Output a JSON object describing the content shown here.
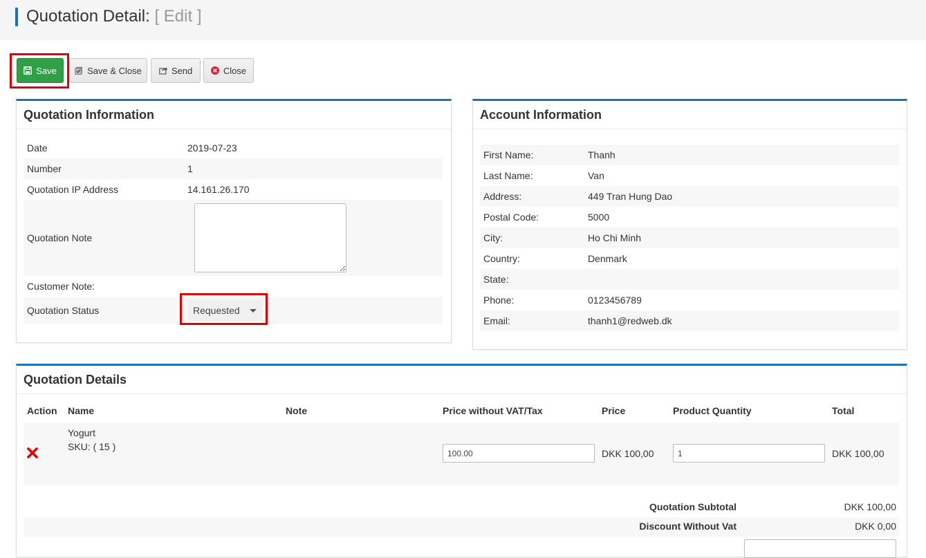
{
  "header": {
    "title": "Quotation Detail:",
    "mode": "[ Edit ]"
  },
  "toolbar": {
    "save": "Save",
    "save_close": "Save & Close",
    "send": "Send",
    "close": "Close"
  },
  "quotation_info": {
    "title": "Quotation Information",
    "rows": [
      {
        "label": "Date",
        "value": "2019-07-23"
      },
      {
        "label": "Number",
        "value": "1"
      },
      {
        "label": "Quotation IP Address",
        "value": "14.161.26.170"
      },
      {
        "label": "Quotation Note",
        "value": ""
      },
      {
        "label": "Customer Note:",
        "value": ""
      },
      {
        "label": "Quotation Status",
        "value": "Requested"
      }
    ]
  },
  "account_info": {
    "title": "Account Information",
    "rows": [
      {
        "label": "First Name:",
        "value": "Thanh"
      },
      {
        "label": "Last Name:",
        "value": "Van"
      },
      {
        "label": "Address:",
        "value": "449 Tran Hung Dao"
      },
      {
        "label": "Postal Code:",
        "value": "5000"
      },
      {
        "label": "City:",
        "value": "Ho Chi Minh"
      },
      {
        "label": "Country:",
        "value": "Denmark"
      },
      {
        "label": "State:",
        "value": ""
      },
      {
        "label": "Phone:",
        "value": "0123456789"
      },
      {
        "label": "Email:",
        "value": "thanh1@redweb.dk"
      }
    ]
  },
  "details": {
    "title": "Quotation Details",
    "columns": [
      "Action",
      "Name",
      "Note",
      "Price without VAT/Tax",
      "Price",
      "Product Quantity",
      "Total"
    ],
    "items": [
      {
        "name": "Yogurt",
        "sku": "SKU: ( 15 )",
        "note": "",
        "price_without_vat": "100.00",
        "price": "DKK 100,00",
        "quantity": "1",
        "total": "DKK 100,00"
      }
    ],
    "summary": [
      {
        "label": "Quotation Subtotal",
        "value": "DKK 100,00"
      },
      {
        "label": "Discount Without Vat",
        "value": "DKK 0,00"
      }
    ]
  },
  "colors": {
    "accent": "#1b73b3",
    "success": "#2f9f48",
    "highlight": "#e00000",
    "delete": "#e00000"
  },
  "icons": {
    "save": "floppy-disk-icon",
    "save_close": "save-close-icon",
    "send": "share-icon",
    "close": "close-circle-icon",
    "delete": "remove-x-icon"
  }
}
